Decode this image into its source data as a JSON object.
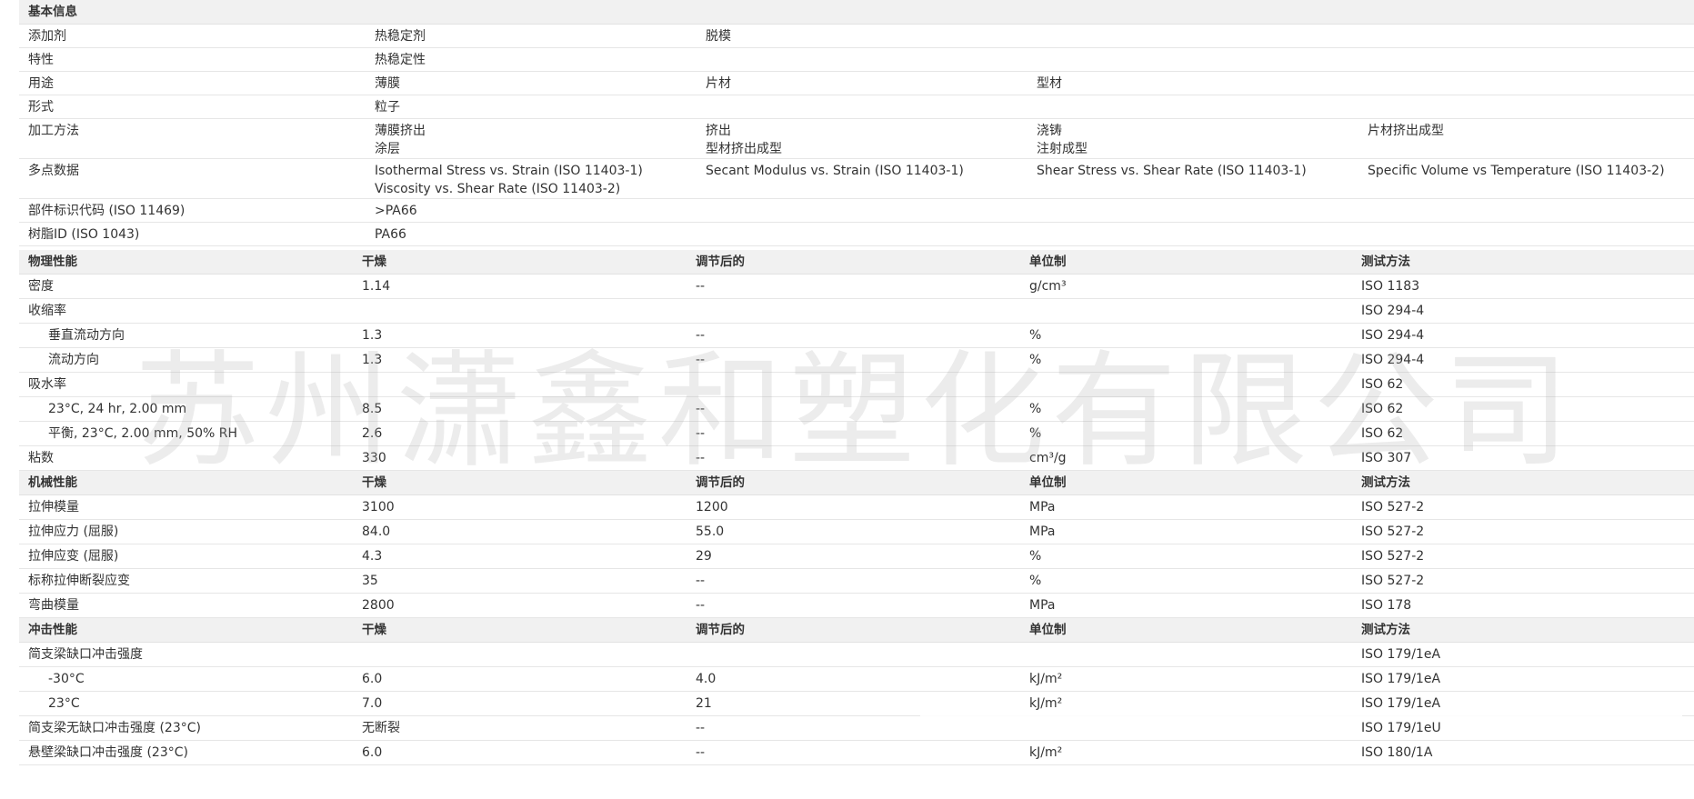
{
  "basic": {
    "title": "基本信息",
    "rows": [
      {
        "label": "添加剂",
        "c1": "热稳定剂",
        "c2": "脱模",
        "c3": "",
        "c4": ""
      },
      {
        "label": "特性",
        "c1": "热稳定性",
        "c2": "",
        "c3": "",
        "c4": ""
      },
      {
        "label": "用途",
        "c1": "薄膜",
        "c2": "片材",
        "c3": "型材",
        "c4": ""
      },
      {
        "label": "形式",
        "c1": "粒子",
        "c2": "",
        "c3": "",
        "c4": ""
      },
      {
        "label": "加工方法",
        "c1": "薄膜挤出",
        "c1b": "涂层",
        "c2": "挤出",
        "c2b": "型材挤出成型",
        "c3": "浇铸",
        "c3b": "注射成型",
        "c4": "片材挤出成型"
      },
      {
        "label": "多点数据",
        "c1": "Isothermal Stress vs. Strain (ISO 11403-1)",
        "c1b": "Viscosity vs. Shear Rate (ISO 11403-2)",
        "c2": "Secant Modulus vs. Strain (ISO 11403-1)",
        "c3": "Shear Stress vs. Shear Rate (ISO 11403-1)",
        "c4": "Specific Volume vs Temperature (ISO 11403-2)"
      },
      {
        "label": "部件标识代码 (ISO 11469)",
        "c1": ">PA66",
        "c2": "",
        "c3": "",
        "c4": ""
      },
      {
        "label": "树脂ID (ISO 1043)",
        "c1": "PA66",
        "c2": "",
        "c3": "",
        "c4": ""
      }
    ]
  },
  "physical": {
    "header": {
      "name": "物理性能",
      "dry": "干燥",
      "cond": "调节后的",
      "unit": "单位制",
      "method": "测试方法"
    },
    "rows": [
      {
        "name": "密度",
        "dry": "1.14",
        "cond": "--",
        "unit": "g/cm³",
        "method": "ISO 1183"
      },
      {
        "name": "收缩率",
        "dry": "",
        "cond": "",
        "unit": "",
        "method": "ISO 294-4"
      },
      {
        "name": "垂直流动方向",
        "dry": "1.3",
        "cond": "--",
        "unit": "%",
        "method": "ISO 294-4",
        "indent": true
      },
      {
        "name": "流动方向",
        "dry": "1.3",
        "cond": "--",
        "unit": "%",
        "method": "ISO 294-4",
        "indent": true
      },
      {
        "name": "吸水率",
        "dry": "",
        "cond": "",
        "unit": "",
        "method": "ISO 62"
      },
      {
        "name": "23°C, 24 hr, 2.00 mm",
        "dry": "8.5",
        "cond": "--",
        "unit": "%",
        "method": "ISO 62",
        "indent": true
      },
      {
        "name": "平衡, 23°C, 2.00 mm, 50% RH",
        "dry": "2.6",
        "cond": "--",
        "unit": "%",
        "method": "ISO 62",
        "indent": true
      },
      {
        "name": "粘数",
        "dry": "330",
        "cond": "--",
        "unit": "cm³/g",
        "method": "ISO 307"
      }
    ]
  },
  "mechanical": {
    "header": {
      "name": "机械性能",
      "dry": "干燥",
      "cond": "调节后的",
      "unit": "单位制",
      "method": "测试方法"
    },
    "rows": [
      {
        "name": "拉伸模量",
        "dry": "3100",
        "cond": "1200",
        "unit": "MPa",
        "method": "ISO 527-2"
      },
      {
        "name": "拉伸应力 (屈服)",
        "dry": "84.0",
        "cond": "55.0",
        "unit": "MPa",
        "method": "ISO 527-2"
      },
      {
        "name": "拉伸应变 (屈服)",
        "dry": "4.3",
        "cond": "29",
        "unit": "%",
        "method": "ISO 527-2"
      },
      {
        "name": "标称拉伸断裂应变",
        "dry": "35",
        "cond": "--",
        "unit": "%",
        "method": "ISO 527-2"
      },
      {
        "name": "弯曲模量",
        "dry": "2800",
        "cond": "--",
        "unit": "MPa",
        "method": "ISO 178"
      }
    ]
  },
  "impact": {
    "header": {
      "name": "冲击性能",
      "dry": "干燥",
      "cond": "调节后的",
      "unit": "单位制",
      "method": "测试方法"
    },
    "rows": [
      {
        "name": "简支梁缺口冲击强度",
        "dry": "",
        "cond": "",
        "unit": "",
        "method": "ISO 179/1eA"
      },
      {
        "name": "-30°C",
        "dry": "6.0",
        "cond": "4.0",
        "unit": "kJ/m²",
        "method": "ISO 179/1eA",
        "indent": true
      },
      {
        "name": "23°C",
        "dry": "7.0",
        "cond": "21",
        "unit": "kJ/m²",
        "method": "ISO 179/1eA",
        "indent": true
      },
      {
        "name": "简支梁无缺口冲击强度 (23°C)",
        "dry": "无断裂",
        "cond": "--",
        "unit": "",
        "method": "ISO 179/1eU"
      },
      {
        "name": "悬壁梁缺口冲击强度 (23°C)",
        "dry": "6.0",
        "cond": "--",
        "unit": "kJ/m²",
        "method": "ISO 180/1A"
      }
    ]
  },
  "watermark": "苏州潇鑫和塑化有限公司"
}
